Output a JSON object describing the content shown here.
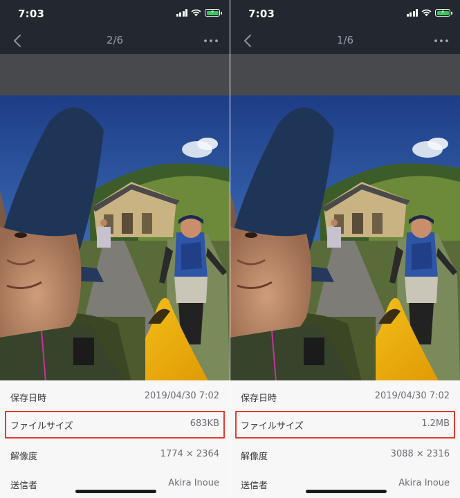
{
  "panels": [
    {
      "status_time": "7:03",
      "counter": "2/6",
      "details": [
        {
          "label": "保存日時",
          "value": "2019/04/30 7:02"
        },
        {
          "label": "ファイルサイズ",
          "value": "683KB",
          "highlighted": true
        },
        {
          "label": "解像度",
          "value": "1774 × 2364"
        },
        {
          "label": "送信者",
          "value": "Akira Inoue"
        }
      ]
    },
    {
      "status_time": "7:03",
      "counter": "1/6",
      "details": [
        {
          "label": "保存日時",
          "value": "2019/04/30 7:02"
        },
        {
          "label": "ファイルサイズ",
          "value": "1.2MB",
          "highlighted": true
        },
        {
          "label": "解像度",
          "value": "3088 × 2316"
        },
        {
          "label": "送信者",
          "value": "Akira Inoue"
        }
      ]
    }
  ],
  "icons": {
    "back": "chevron-left-icon",
    "more": "more-horizontal-icon",
    "signal": "cellular-signal-icon",
    "wifi": "wifi-icon",
    "battery": "battery-charging-icon"
  },
  "colors": {
    "header_bg": "#23272f",
    "highlight_border": "#e33b2e",
    "battery_fill": "#35c759",
    "info_bg": "#f7f7f8"
  }
}
